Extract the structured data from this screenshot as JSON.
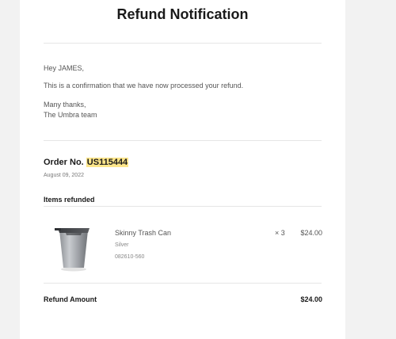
{
  "header": {
    "title": "Refund Notification"
  },
  "message": {
    "greeting": "Hey JAMES,",
    "confirmation": "This is a confirmation that we have now processed your refund.",
    "signoff_line1": "Many thanks,",
    "signoff_line2": "The Umbra team"
  },
  "order": {
    "label": "Order No.",
    "number": "US115444",
    "date": "August 09, 2022"
  },
  "items_section": {
    "heading": "Items refunded",
    "items": [
      {
        "name": "Skinny Trash Can",
        "variant": "Silver",
        "sku": "082610-560",
        "quantity": "× 3",
        "price": "$24.00",
        "image_icon": "trash-can-image"
      }
    ]
  },
  "totals": {
    "refund_label": "Refund Amount",
    "refund_value": "$24.00"
  },
  "colors": {
    "page_background": "#f2f2f2",
    "card_background": "#ffffff",
    "highlight": "#fde58a",
    "divider": "#e6e6e6"
  }
}
